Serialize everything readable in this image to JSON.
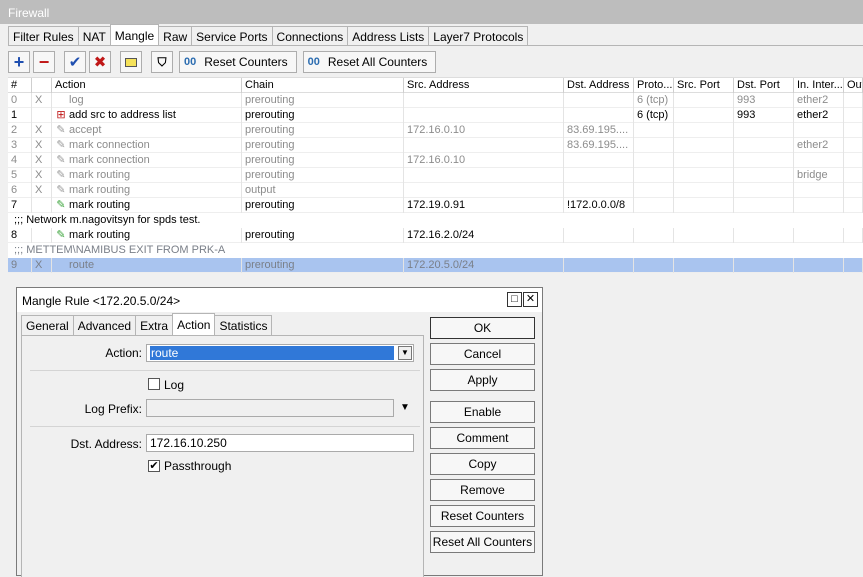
{
  "window": {
    "title": "Firewall"
  },
  "tabs": [
    "Filter Rules",
    "NAT",
    "Mangle",
    "Raw",
    "Service Ports",
    "Connections",
    "Address Lists",
    "Layer7 Protocols"
  ],
  "active_tab": "Mangle",
  "toolbar": {
    "reset_counters": "Reset Counters",
    "reset_all_counters": "Reset All Counters"
  },
  "table": {
    "headers": [
      "#",
      "",
      "Action",
      "Chain",
      "Src. Address",
      "Dst. Address",
      "Proto...",
      "Src. Port",
      "Dst. Port",
      "In. Inter...",
      "Out"
    ],
    "rows": [
      {
        "num": "0",
        "flag": "X",
        "action": "log",
        "chain": "prerouting",
        "src": "",
        "dst": "",
        "proto": "6 (tcp)",
        "sport": "",
        "dport": "993",
        "in": "ether2",
        "icon": "none",
        "disabled": true
      },
      {
        "num": "1",
        "flag": "",
        "action": "add src to address list",
        "chain": "prerouting",
        "src": "",
        "dst": "",
        "proto": "6 (tcp)",
        "sport": "",
        "dport": "993",
        "in": "ether2",
        "icon": "list",
        "disabled": false
      },
      {
        "num": "2",
        "flag": "X",
        "action": "accept",
        "chain": "prerouting",
        "src": "172.16.0.10",
        "dst": "83.69.195....",
        "proto": "",
        "sport": "",
        "dport": "",
        "in": "",
        "icon": "pen",
        "disabled": true
      },
      {
        "num": "3",
        "flag": "X",
        "action": "mark connection",
        "chain": "prerouting",
        "src": "",
        "dst": "83.69.195....",
        "proto": "",
        "sport": "",
        "dport": "",
        "in": "ether2",
        "icon": "pen",
        "disabled": true
      },
      {
        "num": "4",
        "flag": "X",
        "action": "mark connection",
        "chain": "prerouting",
        "src": "172.16.0.10",
        "dst": "",
        "proto": "",
        "sport": "",
        "dport": "",
        "in": "",
        "icon": "pen",
        "disabled": true
      },
      {
        "num": "5",
        "flag": "X",
        "action": "mark routing",
        "chain": "prerouting",
        "src": "",
        "dst": "",
        "proto": "",
        "sport": "",
        "dport": "",
        "in": "bridge",
        "icon": "pen",
        "disabled": true
      },
      {
        "num": "6",
        "flag": "X",
        "action": "mark routing",
        "chain": "output",
        "src": "",
        "dst": "",
        "proto": "",
        "sport": "",
        "dport": "",
        "in": "",
        "icon": "pen",
        "disabled": true
      },
      {
        "num": "7",
        "flag": "",
        "action": "mark routing",
        "chain": "prerouting",
        "src": "172.19.0.91",
        "dst": "!172.0.0.0/8",
        "proto": "",
        "sport": "",
        "dport": "",
        "in": "",
        "icon": "pen-green",
        "disabled": false
      }
    ],
    "comment_1": ";;; Network m.nagovitsyn for spds test.",
    "row_8": {
      "num": "8",
      "flag": "",
      "action": "mark routing",
      "chain": "prerouting",
      "src": "172.16.2.0/24",
      "icon": "pen-green"
    },
    "comment_2": ";;; METTEM\\NAMIBUS EXIT FROM PRK-A",
    "row_9": {
      "num": "9",
      "flag": "X",
      "action": "route",
      "chain": "prerouting",
      "src": "172.20.5.0/24"
    }
  },
  "dialog": {
    "title": "Mangle Rule <172.20.5.0/24>",
    "tabs": [
      "General",
      "Advanced",
      "Extra",
      "Action",
      "Statistics"
    ],
    "active_tab": "Action",
    "action_label": "Action:",
    "action_value": "route",
    "log_label": "Log",
    "log_checked": false,
    "log_prefix_label": "Log Prefix:",
    "log_prefix_value": "",
    "dst_address_label": "Dst. Address:",
    "dst_address_value": "172.16.10.250",
    "passthrough_label": "Passthrough",
    "passthrough_checked": true,
    "buttons": [
      "OK",
      "Cancel",
      "Apply",
      "Enable",
      "Comment",
      "Copy",
      "Remove",
      "Reset Counters",
      "Reset All Counters"
    ]
  }
}
